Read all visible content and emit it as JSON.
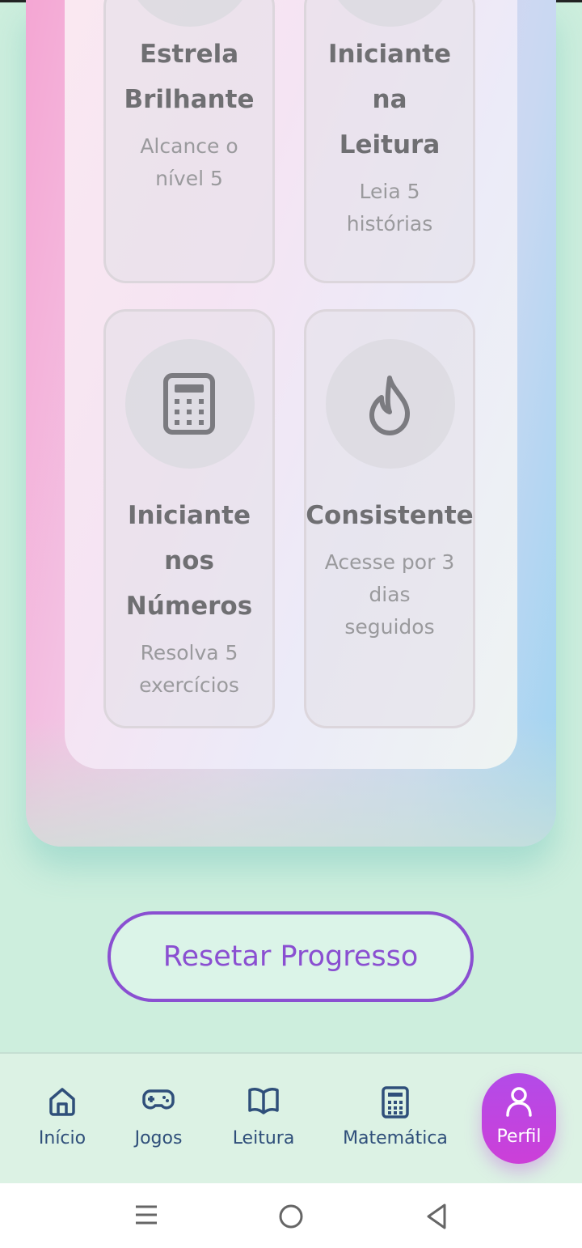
{
  "badges": [
    {
      "title": "Estrela Brilhante",
      "desc": "Alcance o nível 5",
      "icon": "star-icon"
    },
    {
      "title": "Iniciante na Leitura",
      "desc": "Leia 5 histórias",
      "icon": "book-icon"
    },
    {
      "title": "Iniciante nos Números",
      "desc": "Resolva 5 exercícios",
      "icon": "calculator-icon"
    },
    {
      "title": "Consistente",
      "desc": "Acesse por 3 dias seguidos",
      "icon": "flame-icon"
    }
  ],
  "reset_button": {
    "label": "Resetar Progresso"
  },
  "nav": {
    "items": [
      {
        "label": "Início",
        "icon": "home-icon"
      },
      {
        "label": "Jogos",
        "icon": "gamepad-icon"
      },
      {
        "label": "Leitura",
        "icon": "book-open-icon"
      },
      {
        "label": "Matemática",
        "icon": "calculator-icon"
      },
      {
        "label": "Perfil",
        "icon": "user-icon",
        "active": true
      }
    ]
  },
  "colors": {
    "accent": "#8a4fd1",
    "nav_text": "#2f4f7a",
    "active_pill": "#c043e0"
  }
}
